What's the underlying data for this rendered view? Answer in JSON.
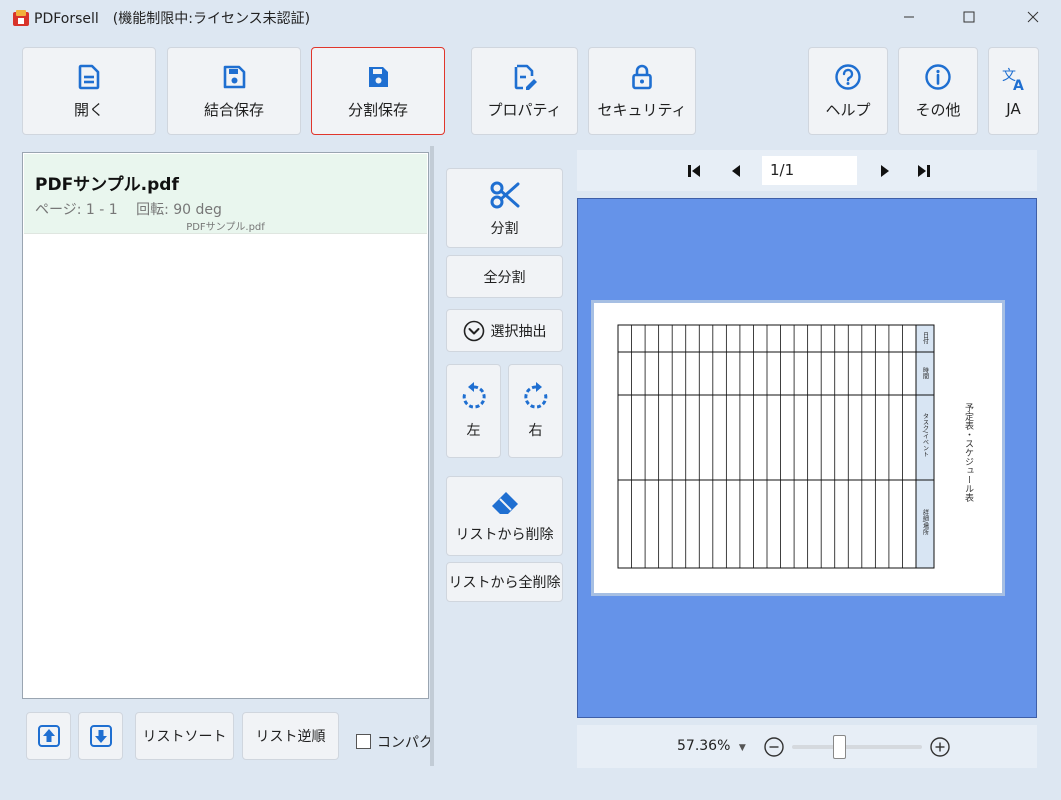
{
  "window": {
    "title": "PDForsell　(機能制限中:ライセンス未認証)",
    "minimize": "—",
    "maximize": "☐",
    "close": "✕"
  },
  "toolbar": {
    "open": "開く",
    "merge_save": "結合保存",
    "split_save": "分割保存",
    "properties": "プロパティ",
    "security": "セキュリティ",
    "help": "ヘルプ",
    "other": "その他",
    "language": "JA"
  },
  "file_list": [
    {
      "name": "PDFサンプル.pdf",
      "meta": "ページ:  1 - 1　 回転:  90 deg",
      "subtitle": "PDFサンプル.pdf"
    }
  ],
  "actions": {
    "split": "分割",
    "split_all": "全分割",
    "select_extract": "選択抽出",
    "rotate_left": "左",
    "rotate_right": "右",
    "remove_from_list": "リストから削除",
    "remove_all_from_list": "リストから全削除"
  },
  "list_controls": {
    "sort": "リストソート",
    "reverse": "リスト逆順",
    "compact_label": "コンパクト",
    "compact_checked": false
  },
  "viewer": {
    "page_indicator": "1/1",
    "zoom": "57.36%",
    "zoom_level": 0.35,
    "page_heading": "予定表・スケジュール表",
    "column_labels": [
      "日付",
      "時間",
      "タスク/イベント",
      "詳細/場所"
    ]
  },
  "colors": {
    "accent": "#1f6fd1",
    "selected_border": "#e0362c",
    "preview_bg": "#6593e9",
    "file_entry_bg": "#e9f6ee"
  }
}
